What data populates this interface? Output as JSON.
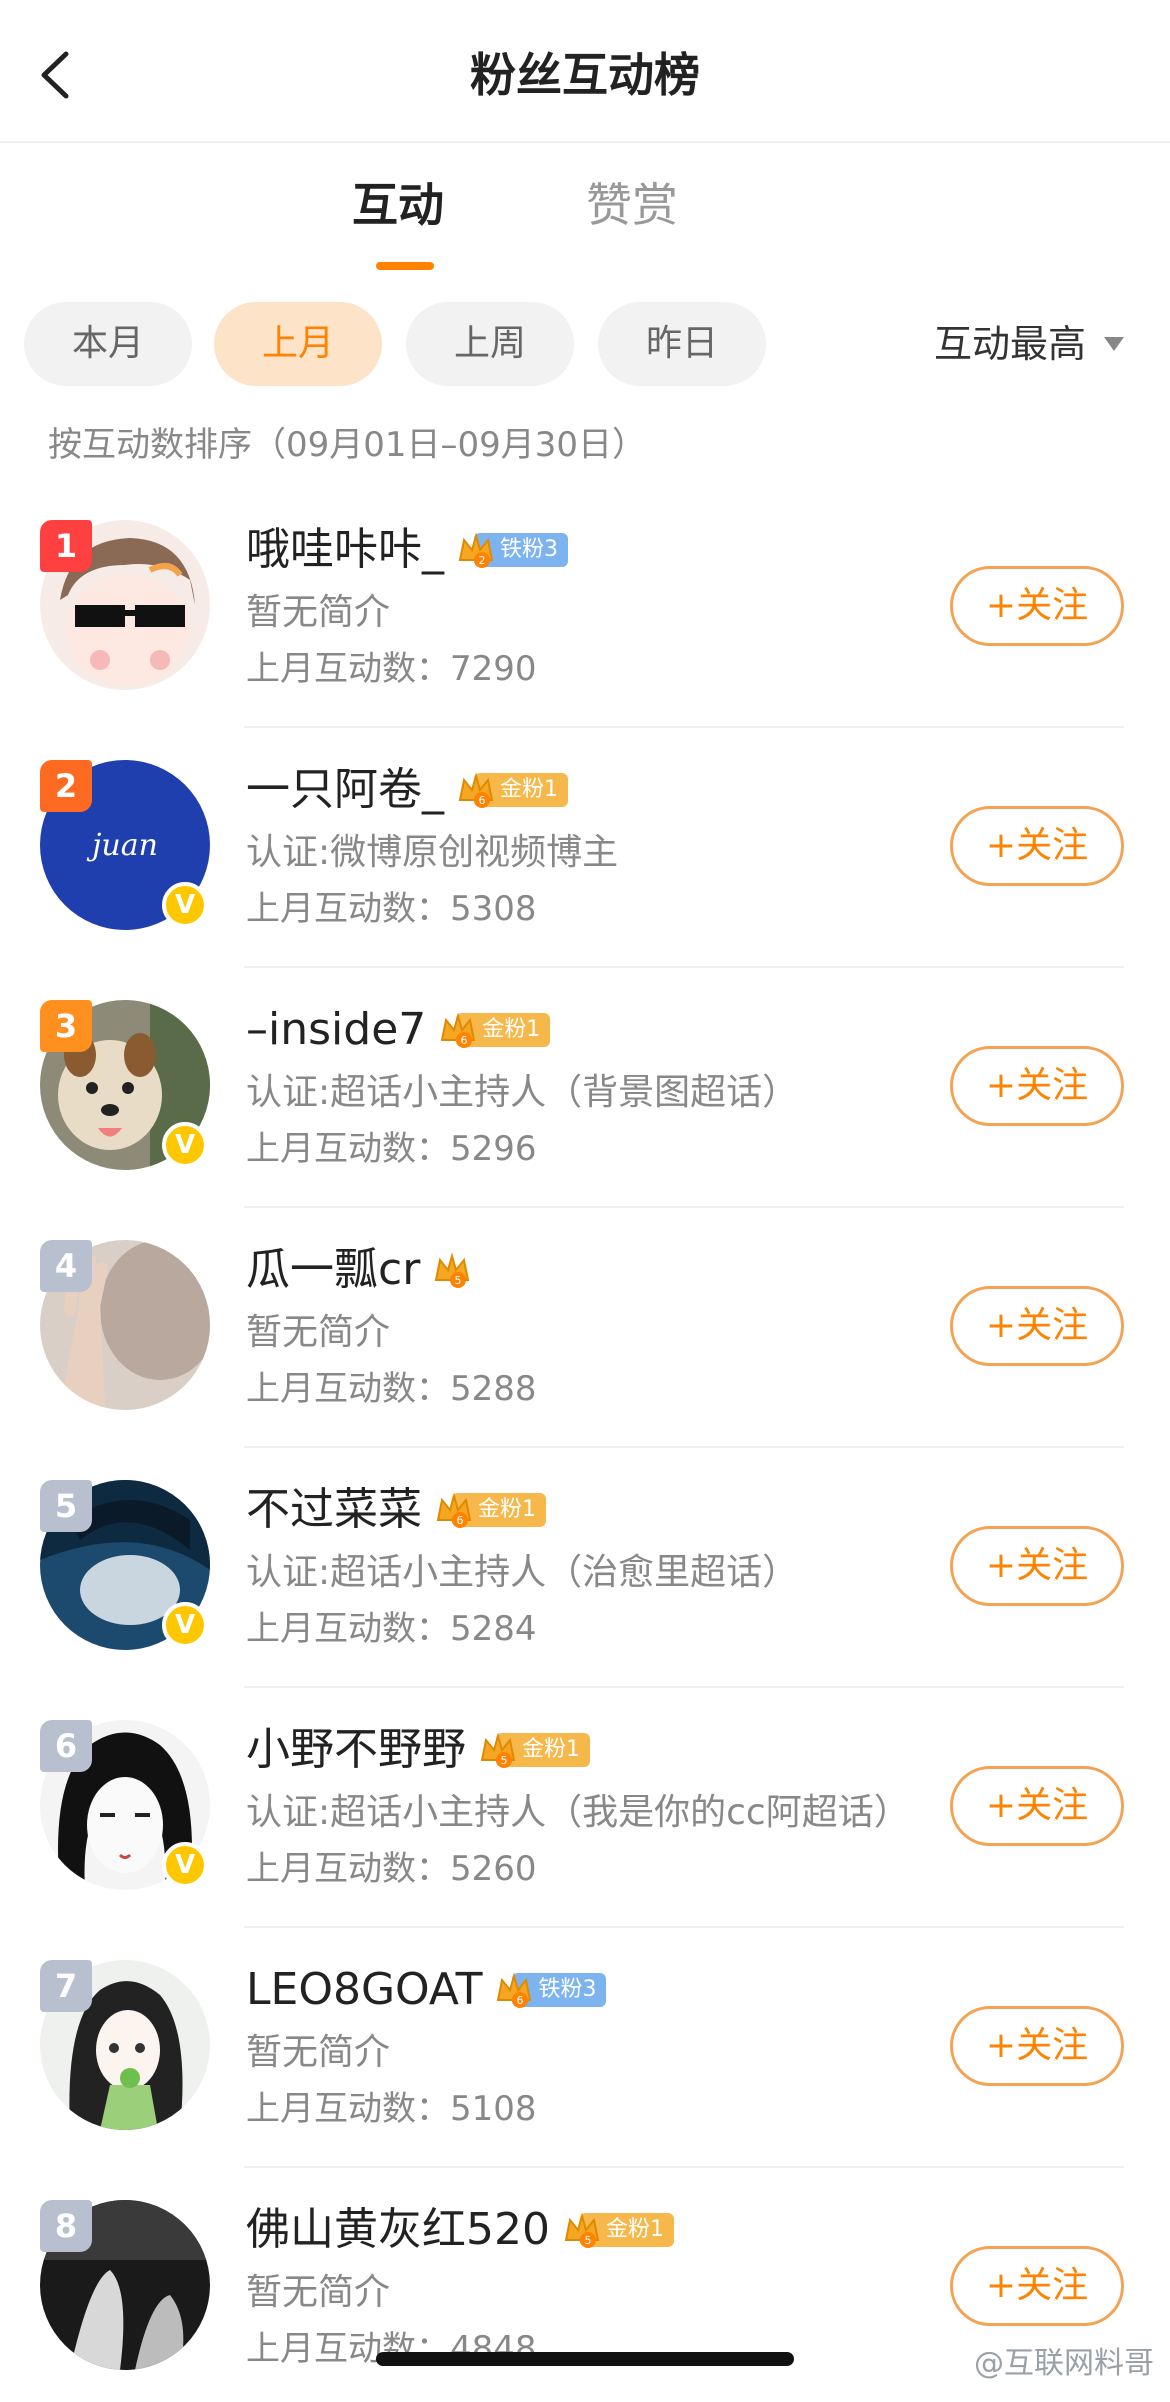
{
  "header": {
    "title": "粉丝互动榜",
    "back_icon": "chevron-left-icon"
  },
  "tabs": [
    {
      "label": "互动",
      "active": true
    },
    {
      "label": "赞赏",
      "active": false
    }
  ],
  "filters": {
    "chips": [
      {
        "label": "本月",
        "active": false
      },
      {
        "label": "上月",
        "active": true
      },
      {
        "label": "上周",
        "active": false
      },
      {
        "label": "昨日",
        "active": false
      }
    ],
    "sort_label": "互动最高"
  },
  "sort_hint": "按互动数排序（09月01日–09月30日）",
  "colors": {
    "accent": "#ff8200",
    "rank1": "#ff4040",
    "rank2": "#ff6a22",
    "rank3": "#ff8f1f",
    "rank_other": "#b8c0d0",
    "verified": "#ffc700"
  },
  "users": [
    {
      "rank": "1",
      "name": "哦哇咔咔_",
      "crown_level": "2",
      "fan_tag": "铁粉3",
      "tag_style": "iron",
      "verified": false,
      "bio": "暂无简介",
      "count_label": "上月互动数：",
      "count": "7290",
      "follow_label": "+关注"
    },
    {
      "rank": "2",
      "name": "一只阿卷_",
      "crown_level": "6",
      "fan_tag": "金粉1",
      "tag_style": "gold",
      "verified": true,
      "bio": "认证:微博原创视频博主",
      "count_label": "上月互动数：",
      "count": "5308",
      "follow_label": "+关注",
      "avatar_text": "juan"
    },
    {
      "rank": "3",
      "name": "–inside7",
      "crown_level": "6",
      "fan_tag": "金粉1",
      "tag_style": "gold",
      "verified": true,
      "bio": "认证:超话小主持人（背景图超话）",
      "count_label": "上月互动数：",
      "count": "5296",
      "follow_label": "+关注"
    },
    {
      "rank": "4",
      "name": "瓜一瓢cr",
      "crown_level": "5",
      "fan_tag": "",
      "tag_style": "",
      "verified": false,
      "bio": "暂无简介",
      "count_label": "上月互动数：",
      "count": "5288",
      "follow_label": "+关注"
    },
    {
      "rank": "5",
      "name": "不过菜菜",
      "crown_level": "6",
      "fan_tag": "金粉1",
      "tag_style": "gold",
      "verified": true,
      "bio": "认证:超话小主持人（治愈里超话）",
      "count_label": "上月互动数：",
      "count": "5284",
      "follow_label": "+关注"
    },
    {
      "rank": "6",
      "name": "小野不野野",
      "crown_level": "5",
      "fan_tag": "金粉1",
      "tag_style": "gold",
      "verified": true,
      "bio": "认证:超话小主持人（我是你的cc阿超话）",
      "count_label": "上月互动数：",
      "count": "5260",
      "follow_label": "+关注"
    },
    {
      "rank": "7",
      "name": "LEO8GOAT",
      "crown_level": "6",
      "fan_tag": "铁粉3",
      "tag_style": "iron",
      "verified": false,
      "bio": "暂无简介",
      "count_label": "上月互动数：",
      "count": "5108",
      "follow_label": "+关注"
    },
    {
      "rank": "8",
      "name": "佛山黄灰红520",
      "crown_level": "5",
      "fan_tag": "金粉1",
      "tag_style": "gold",
      "verified": false,
      "bio": "暂无简介",
      "count_label": "上月互动数：",
      "count": "4848",
      "follow_label": "+关注"
    }
  ],
  "watermark": "@互联网料哥"
}
